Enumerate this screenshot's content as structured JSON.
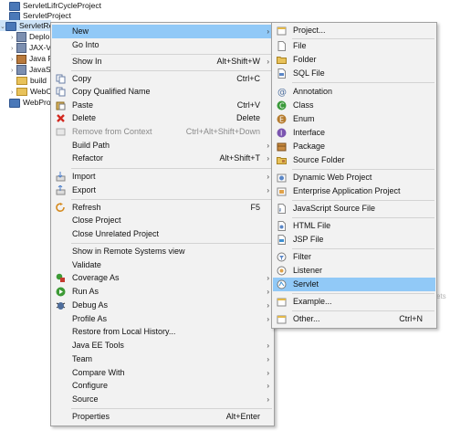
{
  "explorer": {
    "items": [
      {
        "label": "ServletLifrCycleProject"
      },
      {
        "label": "ServletProject"
      },
      {
        "label": "ServletRe"
      },
      {
        "label": "Deplo"
      },
      {
        "label": "JAX-V"
      },
      {
        "label": "Java F"
      },
      {
        "label": "JavaS"
      },
      {
        "label": "build"
      },
      {
        "label": "WebC"
      },
      {
        "label": "WebProj"
      }
    ]
  },
  "background": {
    "ghost_text": "ets"
  },
  "menu": {
    "items": [
      {
        "label": "New",
        "shortcut": "",
        "submenu": true
      },
      {
        "label": "Go Into",
        "shortcut": ""
      },
      {
        "label": "Show In",
        "shortcut": "Alt+Shift+W",
        "submenu": true
      },
      {
        "label": "Copy",
        "shortcut": "Ctrl+C"
      },
      {
        "label": "Copy Qualified Name",
        "shortcut": ""
      },
      {
        "label": "Paste",
        "shortcut": "Ctrl+V"
      },
      {
        "label": "Delete",
        "shortcut": "Delete"
      },
      {
        "label": "Remove from Context",
        "shortcut": "Ctrl+Alt+Shift+Down"
      },
      {
        "label": "Build Path",
        "shortcut": "",
        "submenu": true
      },
      {
        "label": "Refactor",
        "shortcut": "Alt+Shift+T",
        "submenu": true
      },
      {
        "label": "Import",
        "shortcut": "",
        "submenu": true
      },
      {
        "label": "Export",
        "shortcut": "",
        "submenu": true
      },
      {
        "label": "Refresh",
        "shortcut": "F5"
      },
      {
        "label": "Close Project",
        "shortcut": ""
      },
      {
        "label": "Close Unrelated Project",
        "shortcut": ""
      },
      {
        "label": "Show in Remote Systems view",
        "shortcut": ""
      },
      {
        "label": "Validate",
        "shortcut": ""
      },
      {
        "label": "Coverage As",
        "shortcut": "",
        "submenu": true
      },
      {
        "label": "Run As",
        "shortcut": "",
        "submenu": true
      },
      {
        "label": "Debug As",
        "shortcut": "",
        "submenu": true
      },
      {
        "label": "Profile As",
        "shortcut": "",
        "submenu": true
      },
      {
        "label": "Restore from Local History...",
        "shortcut": ""
      },
      {
        "label": "Java EE Tools",
        "shortcut": "",
        "submenu": true
      },
      {
        "label": "Team",
        "shortcut": "",
        "submenu": true
      },
      {
        "label": "Compare With",
        "shortcut": "",
        "submenu": true
      },
      {
        "label": "Configure",
        "shortcut": "",
        "submenu": true
      },
      {
        "label": "Source",
        "shortcut": "",
        "submenu": true
      },
      {
        "label": "Properties",
        "shortcut": "Alt+Enter"
      }
    ]
  },
  "submenu": {
    "items": [
      {
        "label": "Project...",
        "shortcut": ""
      },
      {
        "label": "File",
        "shortcut": ""
      },
      {
        "label": "Folder",
        "shortcut": ""
      },
      {
        "label": "SQL File",
        "shortcut": ""
      },
      {
        "label": "Annotation",
        "shortcut": ""
      },
      {
        "label": "Class",
        "shortcut": ""
      },
      {
        "label": "Enum",
        "shortcut": ""
      },
      {
        "label": "Interface",
        "shortcut": ""
      },
      {
        "label": "Package",
        "shortcut": ""
      },
      {
        "label": "Source Folder",
        "shortcut": ""
      },
      {
        "label": "Dynamic Web Project",
        "shortcut": ""
      },
      {
        "label": "Enterprise Application Project",
        "shortcut": ""
      },
      {
        "label": "JavaScript Source File",
        "shortcut": ""
      },
      {
        "label": "HTML File",
        "shortcut": ""
      },
      {
        "label": "JSP File",
        "shortcut": ""
      },
      {
        "label": "Filter",
        "shortcut": ""
      },
      {
        "label": "Listener",
        "shortcut": ""
      },
      {
        "label": "Servlet",
        "shortcut": ""
      },
      {
        "label": "Example...",
        "shortcut": ""
      },
      {
        "label": "Other...",
        "shortcut": "Ctrl+N"
      }
    ]
  },
  "colors": {
    "highlight": "#91c9f7",
    "menu_bg": "#f2f2f2"
  }
}
